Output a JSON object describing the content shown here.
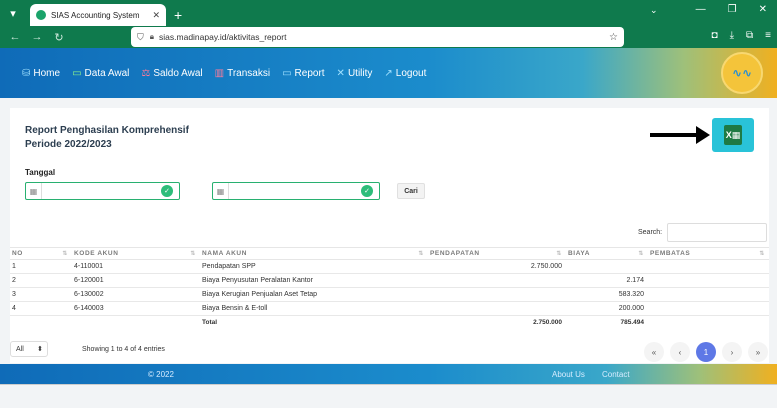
{
  "browser": {
    "tab_title": "SIAS Accounting System",
    "tab_close": "✕",
    "new_tab": "+",
    "url": "sias.madinapay.id/aktivitas_report"
  },
  "menu": {
    "items": [
      {
        "label": "Home",
        "icon": "database-icon"
      },
      {
        "label": "Data Awal",
        "icon": "monitor-icon"
      },
      {
        "label": "Saldo Awal",
        "icon": "scales-icon"
      },
      {
        "label": "Transaksi",
        "icon": "chart-icon"
      },
      {
        "label": "Report",
        "icon": "monitor-icon"
      },
      {
        "label": "Utility",
        "icon": "tools-icon"
      },
      {
        "label": "Logout",
        "icon": "logout-icon"
      }
    ]
  },
  "report": {
    "title_line1": "Report Penghasilan Komprehensif",
    "title_line2": "Periode 2022/2023",
    "tanggal_label": "Tanggal",
    "date_from": "",
    "date_to": "",
    "search_button": "Cari",
    "search_label": "Search:",
    "search_value": ""
  },
  "table": {
    "columns": [
      "NO",
      "KODE AKUN",
      "NAMA AKUN",
      "PENDAPATAN",
      "BIAYA",
      "PEMBATAS"
    ],
    "rows": [
      {
        "no": "1",
        "kode": "4-110001",
        "nama": "Pendapatan SPP",
        "pendapatan": "2.750.000",
        "biaya": "",
        "pembatas": ""
      },
      {
        "no": "2",
        "kode": "6-120001",
        "nama": "Biaya Penyusutan Peralatan Kantor",
        "pendapatan": "",
        "biaya": "2.174",
        "pembatas": ""
      },
      {
        "no": "3",
        "kode": "6-130002",
        "nama": "Biaya Kerugian Penjualan Aset Tetap",
        "pendapatan": "",
        "biaya": "583.320",
        "pembatas": ""
      },
      {
        "no": "4",
        "kode": "6-140003",
        "nama": "Biaya Bensin & E-toll",
        "pendapatan": "",
        "biaya": "200.000",
        "pembatas": ""
      }
    ],
    "total": {
      "label": "Total",
      "pendapatan": "2.750.000",
      "biaya": "785.494"
    }
  },
  "pagination": {
    "length_value": "All",
    "info": "Showing 1 to 4 of 4 entries",
    "first": "«",
    "prev": "‹",
    "current": "1",
    "next": "›",
    "last": "»"
  },
  "footer": {
    "copyright": "© 2022",
    "about": "About Us",
    "contact": "Contact"
  },
  "colors": {
    "header_start": "#0f6bb8",
    "header_end": "#f0b020",
    "excel_button": "#29c3d8",
    "field_border": "#28b070",
    "active_page": "#5e78e6"
  }
}
